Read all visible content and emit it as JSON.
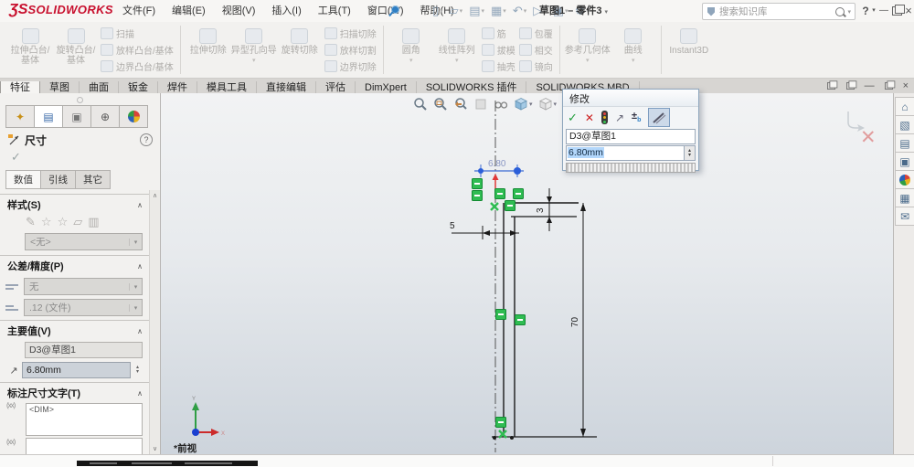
{
  "titlebar": {
    "logo_mark": "ƷS",
    "logo_text": "SOLIDWORKS",
    "menus": [
      "文件(F)",
      "编辑(E)",
      "视图(V)",
      "插入(I)",
      "工具(T)",
      "窗口(W)",
      "帮助(H)"
    ],
    "quick_access": [
      {
        "name": "new-document-icon",
        "glyph": "▯"
      },
      {
        "name": "open-icon",
        "glyph": "▱"
      },
      {
        "name": "save-icon",
        "glyph": "▤"
      },
      {
        "name": "print-icon",
        "glyph": "▦"
      },
      {
        "name": "undo-icon",
        "glyph": "↶"
      },
      {
        "name": "redo-icon",
        "glyph": "▷"
      },
      {
        "name": "selection-icon",
        "glyph": "▣"
      },
      {
        "name": "options-icon",
        "glyph": "⚙"
      }
    ],
    "doc_title": "草图1 – 零件3",
    "search_placeholder": "搜索知识库",
    "help_label": "?",
    "minimize_glyph": "—",
    "close_glyph": "×"
  },
  "ribbon": {
    "groups": [
      {
        "buttons": [
          {
            "label": "拉伸凸台/基体"
          },
          {
            "label": "旋转凸台/基体"
          }
        ],
        "stacks": [
          [
            "扫描",
            "放样凸台/基体",
            "边界凸台/基体"
          ]
        ]
      },
      {
        "buttons": [
          {
            "label": "拉伸切除"
          },
          {
            "label": "异型孔向导",
            "caret": true
          },
          {
            "label": "旋转切除"
          }
        ],
        "stacks": [
          [
            "扫描切除",
            "放样切割",
            "边界切除"
          ]
        ]
      },
      {
        "buttons": [
          {
            "label": "圆角",
            "caret": true
          },
          {
            "label": "线性阵列",
            "caret": true
          }
        ],
        "stacks": [
          [
            "筋",
            "拔模",
            "抽壳"
          ],
          [
            "包覆",
            "相交",
            "镜向"
          ]
        ]
      },
      {
        "buttons": [
          {
            "label": "参考几何体",
            "caret": true
          },
          {
            "label": "曲线",
            "caret": true
          }
        ],
        "stacks": []
      },
      {
        "buttons": [
          {
            "label": "Instant3D"
          }
        ],
        "stacks": []
      }
    ]
  },
  "tabs": {
    "items": [
      "特征",
      "草图",
      "曲面",
      "钣金",
      "焊件",
      "模具工具",
      "直接编辑",
      "评估",
      "DimXpert",
      "SOLIDWORKS 插件",
      "SOLIDWORKS MBD"
    ],
    "active": "特征"
  },
  "property_panel": {
    "title": "尺寸",
    "subtabs": {
      "items": [
        "数值",
        "引线",
        "其它"
      ],
      "active": "数值"
    },
    "style_section": {
      "label": "样式(S)",
      "dropdown_value": "<无>"
    },
    "tolerance_section": {
      "label": "公差/精度(P)",
      "tolerance_value": "无",
      "precision_value": ".12 (文件)"
    },
    "primary_section": {
      "label": "主要值(V)",
      "dim_name": "D3@草图1",
      "dim_value": "6.80mm"
    },
    "dimtext_section": {
      "label": "标注尺寸文字(T)",
      "text": "<DIM>"
    }
  },
  "modify_dialog": {
    "title": "修改",
    "dim_name": "D3@草图1",
    "dim_value": "6.80mm"
  },
  "viewport": {
    "view_label": "*前视",
    "dimensions": {
      "top_width": "6.80",
      "step_height": "3",
      "left_offset": "5",
      "total_height": "70"
    }
  },
  "taskpane": {
    "icons": [
      {
        "name": "home-icon",
        "glyph": "⌂"
      },
      {
        "name": "solidworks-resources-icon",
        "glyph": "▧"
      },
      {
        "name": "design-library-icon",
        "glyph": "▤"
      },
      {
        "name": "file-explorer-icon",
        "glyph": "▣"
      },
      {
        "name": "appearances-icon",
        "glyph": ""
      },
      {
        "name": "custom-properties-icon",
        "glyph": "▦"
      },
      {
        "name": "forum-icon",
        "glyph": "✉"
      }
    ]
  },
  "colors": {
    "constraint_green": "#2fbc52",
    "selected_dim_blue": "#3a6ad4",
    "logo_red": "#c8102e",
    "selection_highlight": "#b3d7fb"
  }
}
